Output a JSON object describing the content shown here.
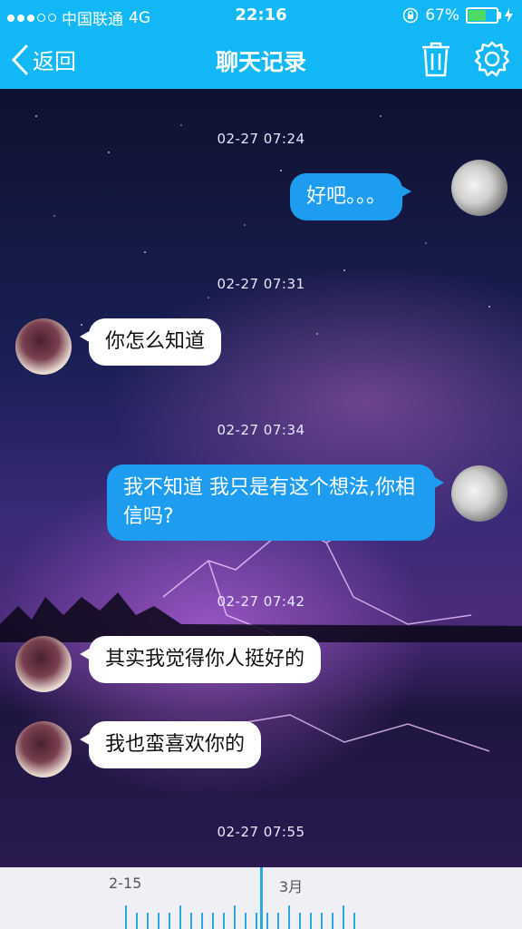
{
  "status_bar": {
    "carrier": "中国联通",
    "network": "4G",
    "time": "22:16",
    "battery_percent": "67%",
    "battery_level": 0.67
  },
  "nav": {
    "back_label": "返回",
    "title": "聊天记录"
  },
  "messages": [
    {
      "timestamp": "02-27 07:24",
      "sender": "me",
      "text": "好吧。。。"
    },
    {
      "timestamp": "02-27 07:31",
      "sender": "other",
      "text": "你怎么知道"
    },
    {
      "timestamp": "02-27 07:34",
      "sender": "me",
      "text": "我不知道 我只是有这个想法,你相信吗?"
    },
    {
      "timestamp": "02-27 07:42",
      "sender": "other",
      "text": "其实我觉得你人挺好的"
    },
    {
      "timestamp": "",
      "sender": "other",
      "text": "我也蛮喜欢你的"
    },
    {
      "timestamp": "02-27 07:55",
      "sender": "",
      "text": ""
    }
  ],
  "timeline": {
    "labels": [
      "2-15",
      "3月"
    ]
  },
  "colors": {
    "accent": "#12b7f5",
    "my_bubble": "#1e9df0",
    "other_bubble": "#ffffff"
  }
}
